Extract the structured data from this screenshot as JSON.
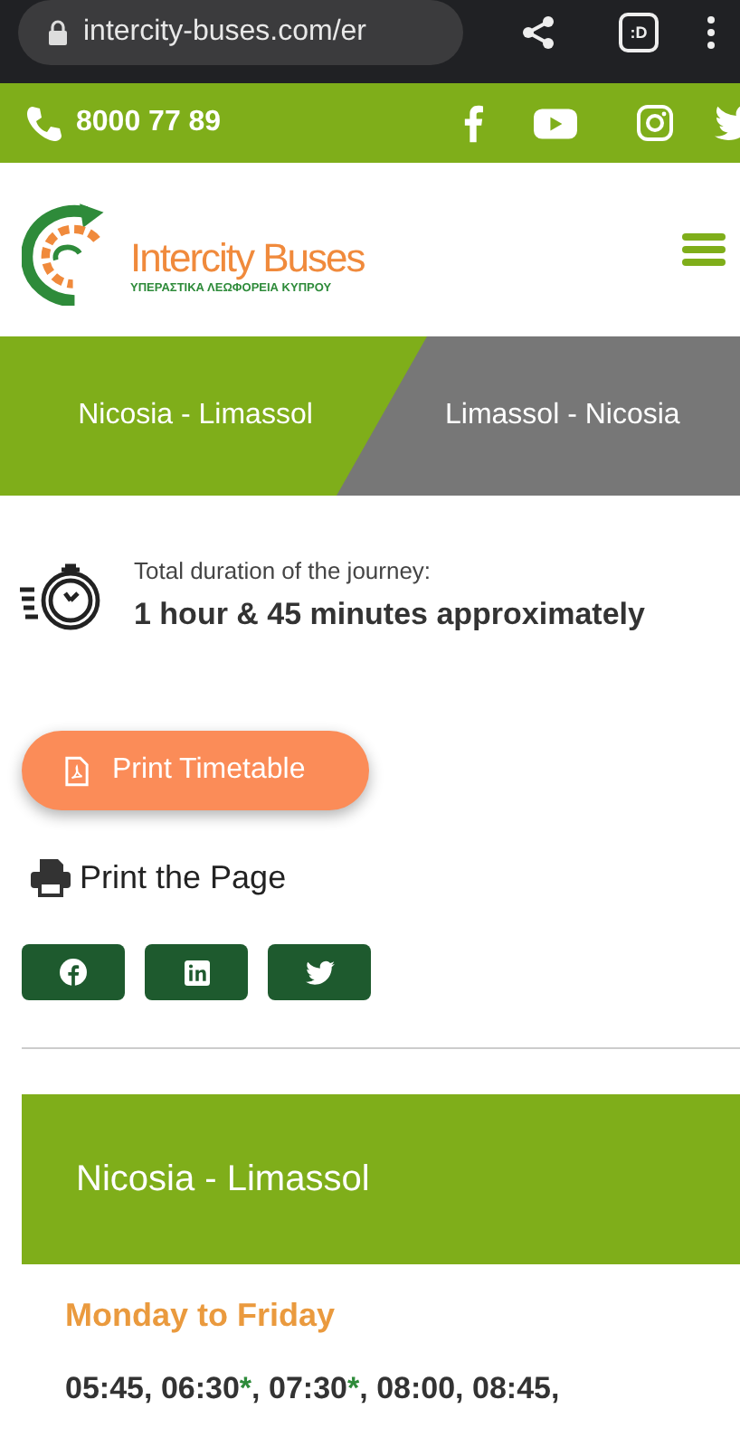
{
  "browser": {
    "url": "intercity-buses.com/er",
    "tab_count": ":D"
  },
  "contact": {
    "phone": "8000 77 89"
  },
  "logo": {
    "name": "Intercity Buses",
    "tagline": "ΥΠΕΡΑΣΤΙΚΑ ΛΕΩΦΟΡΕΙΑ ΚΥΠΡΟΥ"
  },
  "tabs": [
    {
      "label": "Nicosia - Limassol",
      "selected": true
    },
    {
      "label": "Limassol - Nicosia",
      "selected": false
    }
  ],
  "duration": {
    "label": "Total duration of the journey:",
    "value": "1 hour & 45 minutes approximately"
  },
  "print_timetable": "Print Timetable",
  "print_page": "Print the Page",
  "share": [
    {
      "kind": "facebook"
    },
    {
      "kind": "linkedin"
    },
    {
      "kind": "twitter"
    }
  ],
  "route": {
    "title": "Nicosia - Limassol",
    "day": "Monday to Friday",
    "times": [
      {
        "time": "05:45",
        "after": ","
      },
      {
        "time": "06:30",
        "note": "*",
        "after": ","
      },
      {
        "time": "07:30",
        "note": "*",
        "after": ","
      },
      {
        "time": "08:00",
        "after": ","
      },
      {
        "time": "08:45",
        "after": ","
      }
    ]
  }
}
